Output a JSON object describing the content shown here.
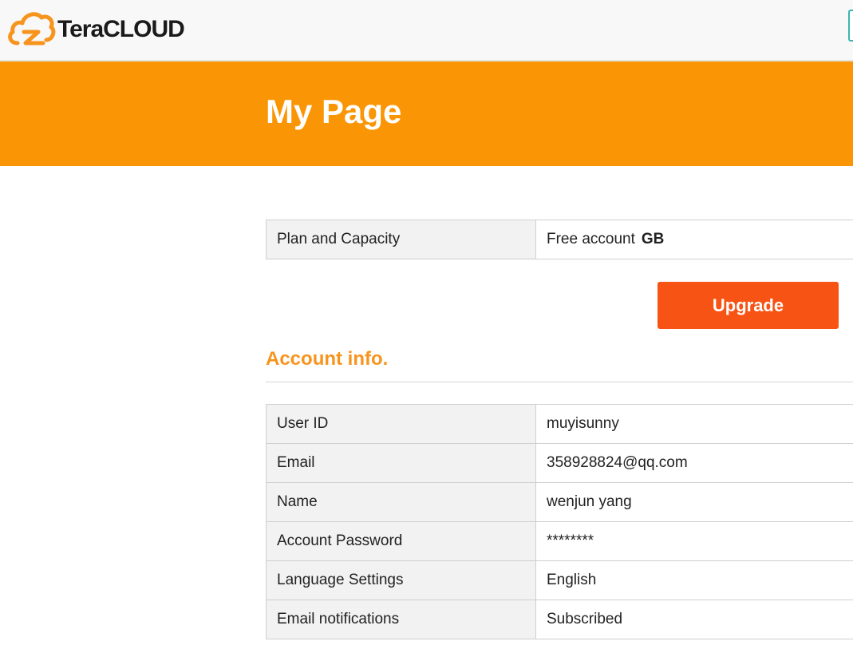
{
  "brand": {
    "logo_text": "TeraCLOUD",
    "accent_color": "#fa9605",
    "logo_color": "#f7941d"
  },
  "banner": {
    "title": "My Page",
    "background_color": "#fa9605"
  },
  "plan": {
    "label": "Plan and Capacity",
    "value": "Free account",
    "unit": "GB"
  },
  "upgrade": {
    "label": "Upgrade",
    "color": "#f65314"
  },
  "account_section": {
    "title": "Account info.",
    "rows": [
      {
        "label": "User ID",
        "value": "muyisunny"
      },
      {
        "label": "Email",
        "value": "358928824@qq.com"
      },
      {
        "label": "Name",
        "value": "wenjun yang"
      },
      {
        "label": "Account Password",
        "value": "********"
      },
      {
        "label": "Language Settings",
        "value": "English"
      },
      {
        "label": "Email notifications",
        "value": "Subscribed"
      }
    ]
  }
}
